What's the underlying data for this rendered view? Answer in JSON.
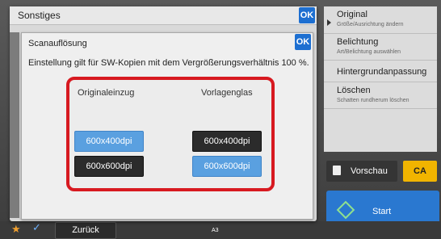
{
  "outer": {
    "title": "Sonstiges",
    "ok": "OK"
  },
  "dialog": {
    "title": "Scanauflösung",
    "ok": "OK",
    "description": "Einstellung gilt für SW-Kopien mit dem Vergrößerungsverhältnis 100 %.",
    "col_left": "Originaleinzug",
    "col_right": "Vorlagenglas",
    "left_options": [
      {
        "label": "600x400dpi",
        "selected": true
      },
      {
        "label": "600x600dpi",
        "selected": false
      }
    ],
    "right_options": [
      {
        "label": "600x400dpi",
        "selected": false
      },
      {
        "label": "600x600dpi",
        "selected": true
      }
    ]
  },
  "menu": {
    "items": [
      {
        "title": "Original",
        "sub": "Größe/Ausrichtung ändern"
      },
      {
        "title": "Belichtung",
        "sub": "Art/Belichtung auswählen"
      },
      {
        "title": "Hintergrundanpassung",
        "sub": ""
      },
      {
        "title": "Löschen",
        "sub": "Schatten rundherum löschen"
      }
    ]
  },
  "bottom": {
    "back": "Zurück",
    "preview": "Vorschau",
    "ca": "CA",
    "start": "Start",
    "tray": "A3"
  },
  "colors": {
    "accent": "#1d6fd1",
    "selected": "#5aa0e0",
    "highlight_border": "#d71920",
    "ca": "#f1b400",
    "start": "#2a78d0"
  }
}
